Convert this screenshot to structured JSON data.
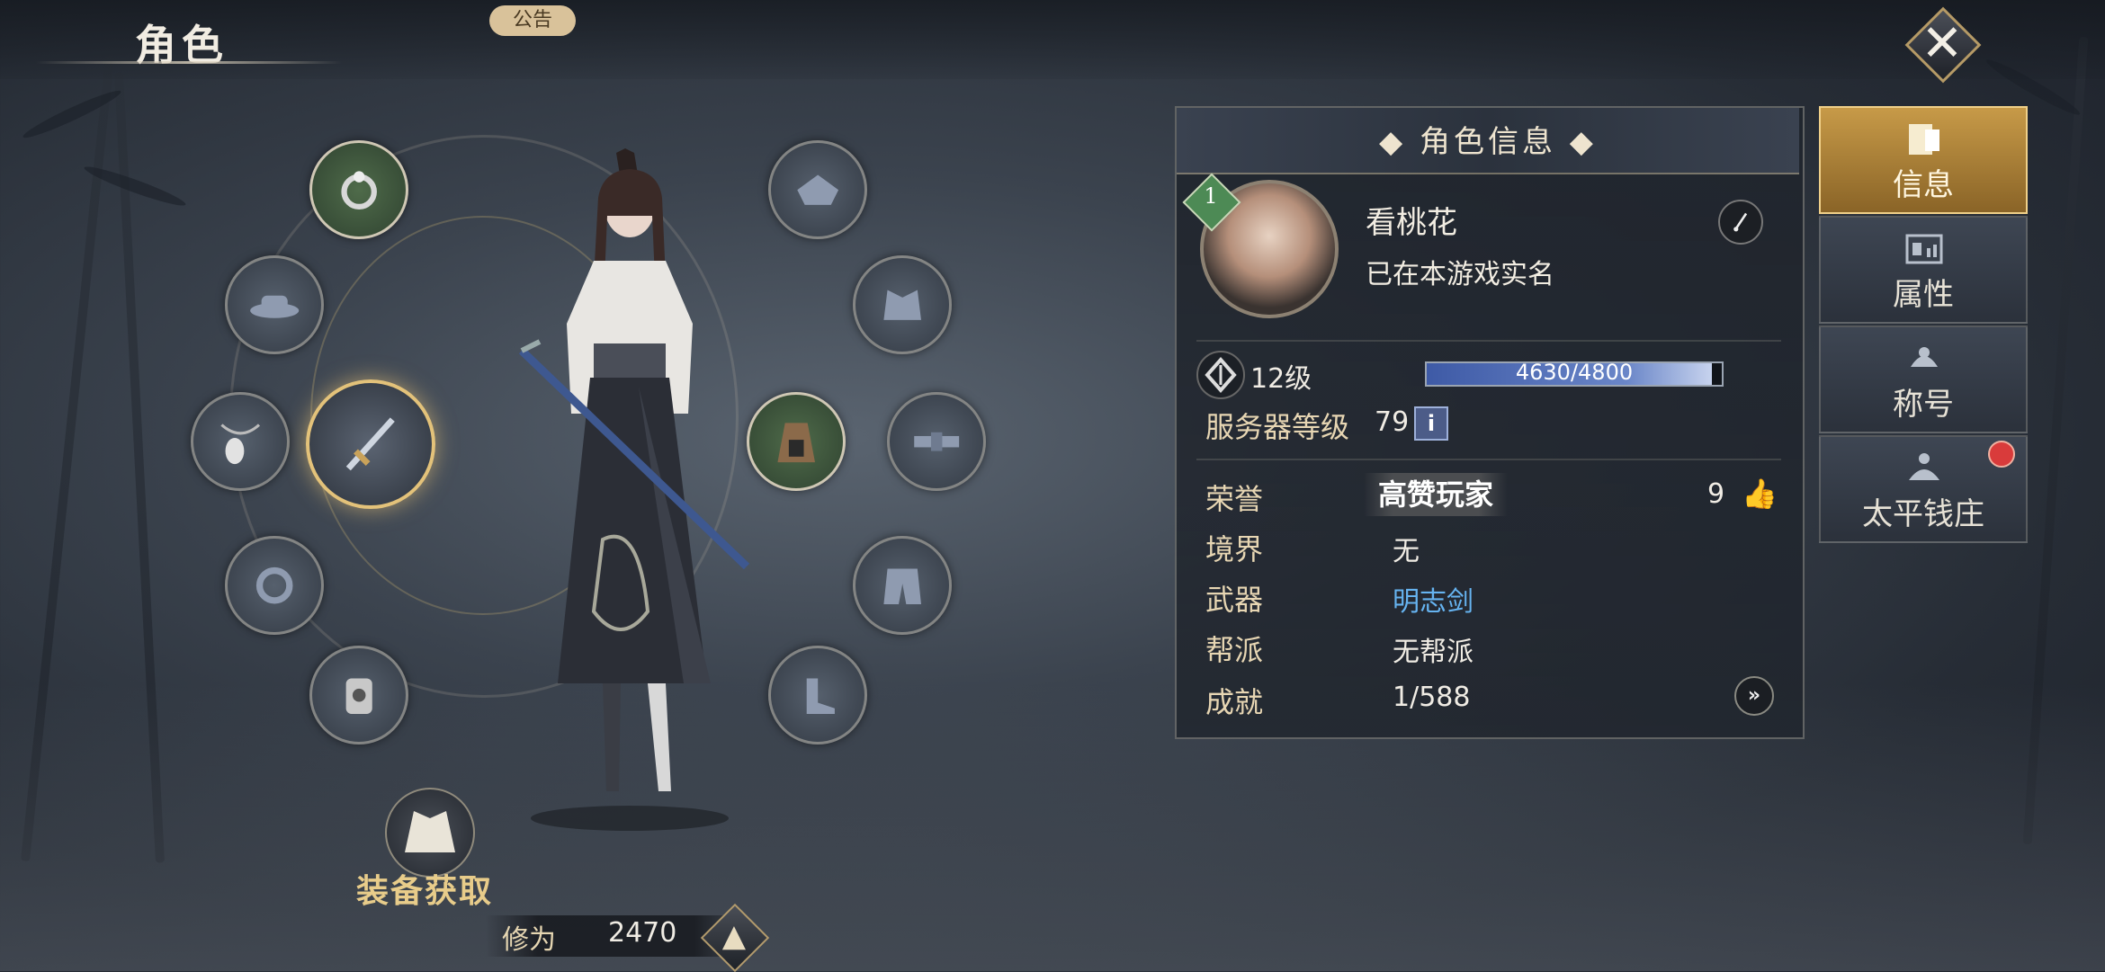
{
  "header": {
    "title": "角色",
    "notice_label": "公告",
    "close_icon": "close-icon"
  },
  "equipment": {
    "acquire_label": "装备获取",
    "cultivation_label": "修为",
    "cultivation_value": "2470"
  },
  "info_panel": {
    "title": "◆ 角色信息 ◆",
    "badge_level": "1",
    "name": "看桃花",
    "real_name_status": "已在本游戏实名",
    "level_label": "12级",
    "xp_text": "4630/4800",
    "xp_fraction": 0.965,
    "server_level_label": "服务器等级",
    "server_level_value": "79",
    "info_icon_label": "i",
    "rows": {
      "honor_label": "荣誉",
      "honor_tag": "高赞玩家",
      "likes": "9",
      "realm_label": "境界",
      "realm_value": "无",
      "weapon_label": "武器",
      "weapon_value": "明志剑",
      "guild_label": "帮派",
      "guild_value": "无帮派",
      "achievement_label": "成就",
      "achievement_value": "1/588"
    }
  },
  "tabs": [
    {
      "label": "信息",
      "icon": "info-card-icon",
      "active": true
    },
    {
      "label": "属性",
      "icon": "stats-icon",
      "active": false
    },
    {
      "label": "称号",
      "icon": "title-scroll-icon",
      "active": false
    },
    {
      "label": "太平钱庄",
      "icon": "bank-icon",
      "active": false
    }
  ],
  "colors": {
    "accent_gold": "#e8cc8a",
    "weapon_blue": "#66b3f0",
    "active_tab": "#c79a48",
    "xp_fill": "#6a86c8"
  }
}
